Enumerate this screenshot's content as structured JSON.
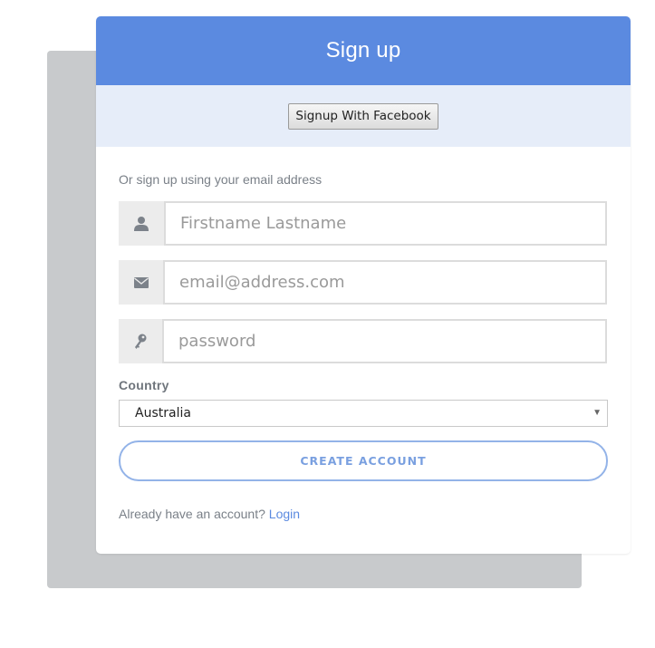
{
  "header": {
    "title": "Sign up"
  },
  "social": {
    "facebook_label": "Signup With Facebook"
  },
  "form": {
    "intro": "Or sign up using your email address",
    "name_placeholder": "Firstname Lastname",
    "name_icon": "user-icon",
    "email_placeholder": "email@address.com",
    "email_icon": "envelope-icon",
    "password_placeholder": "password",
    "password_icon": "key-icon",
    "country_label": "Country",
    "country_selected": "Australia",
    "create_label": "CREATE ACCOUNT"
  },
  "footer": {
    "prompt": "Already have an account?",
    "login_label": "Login"
  },
  "colors": {
    "accent": "#5b8ae0",
    "header_bg": "#5b8ae0",
    "social_bar_bg": "#e6edf9",
    "backdrop": "#c8cacc",
    "button_border": "#93b3e8"
  }
}
